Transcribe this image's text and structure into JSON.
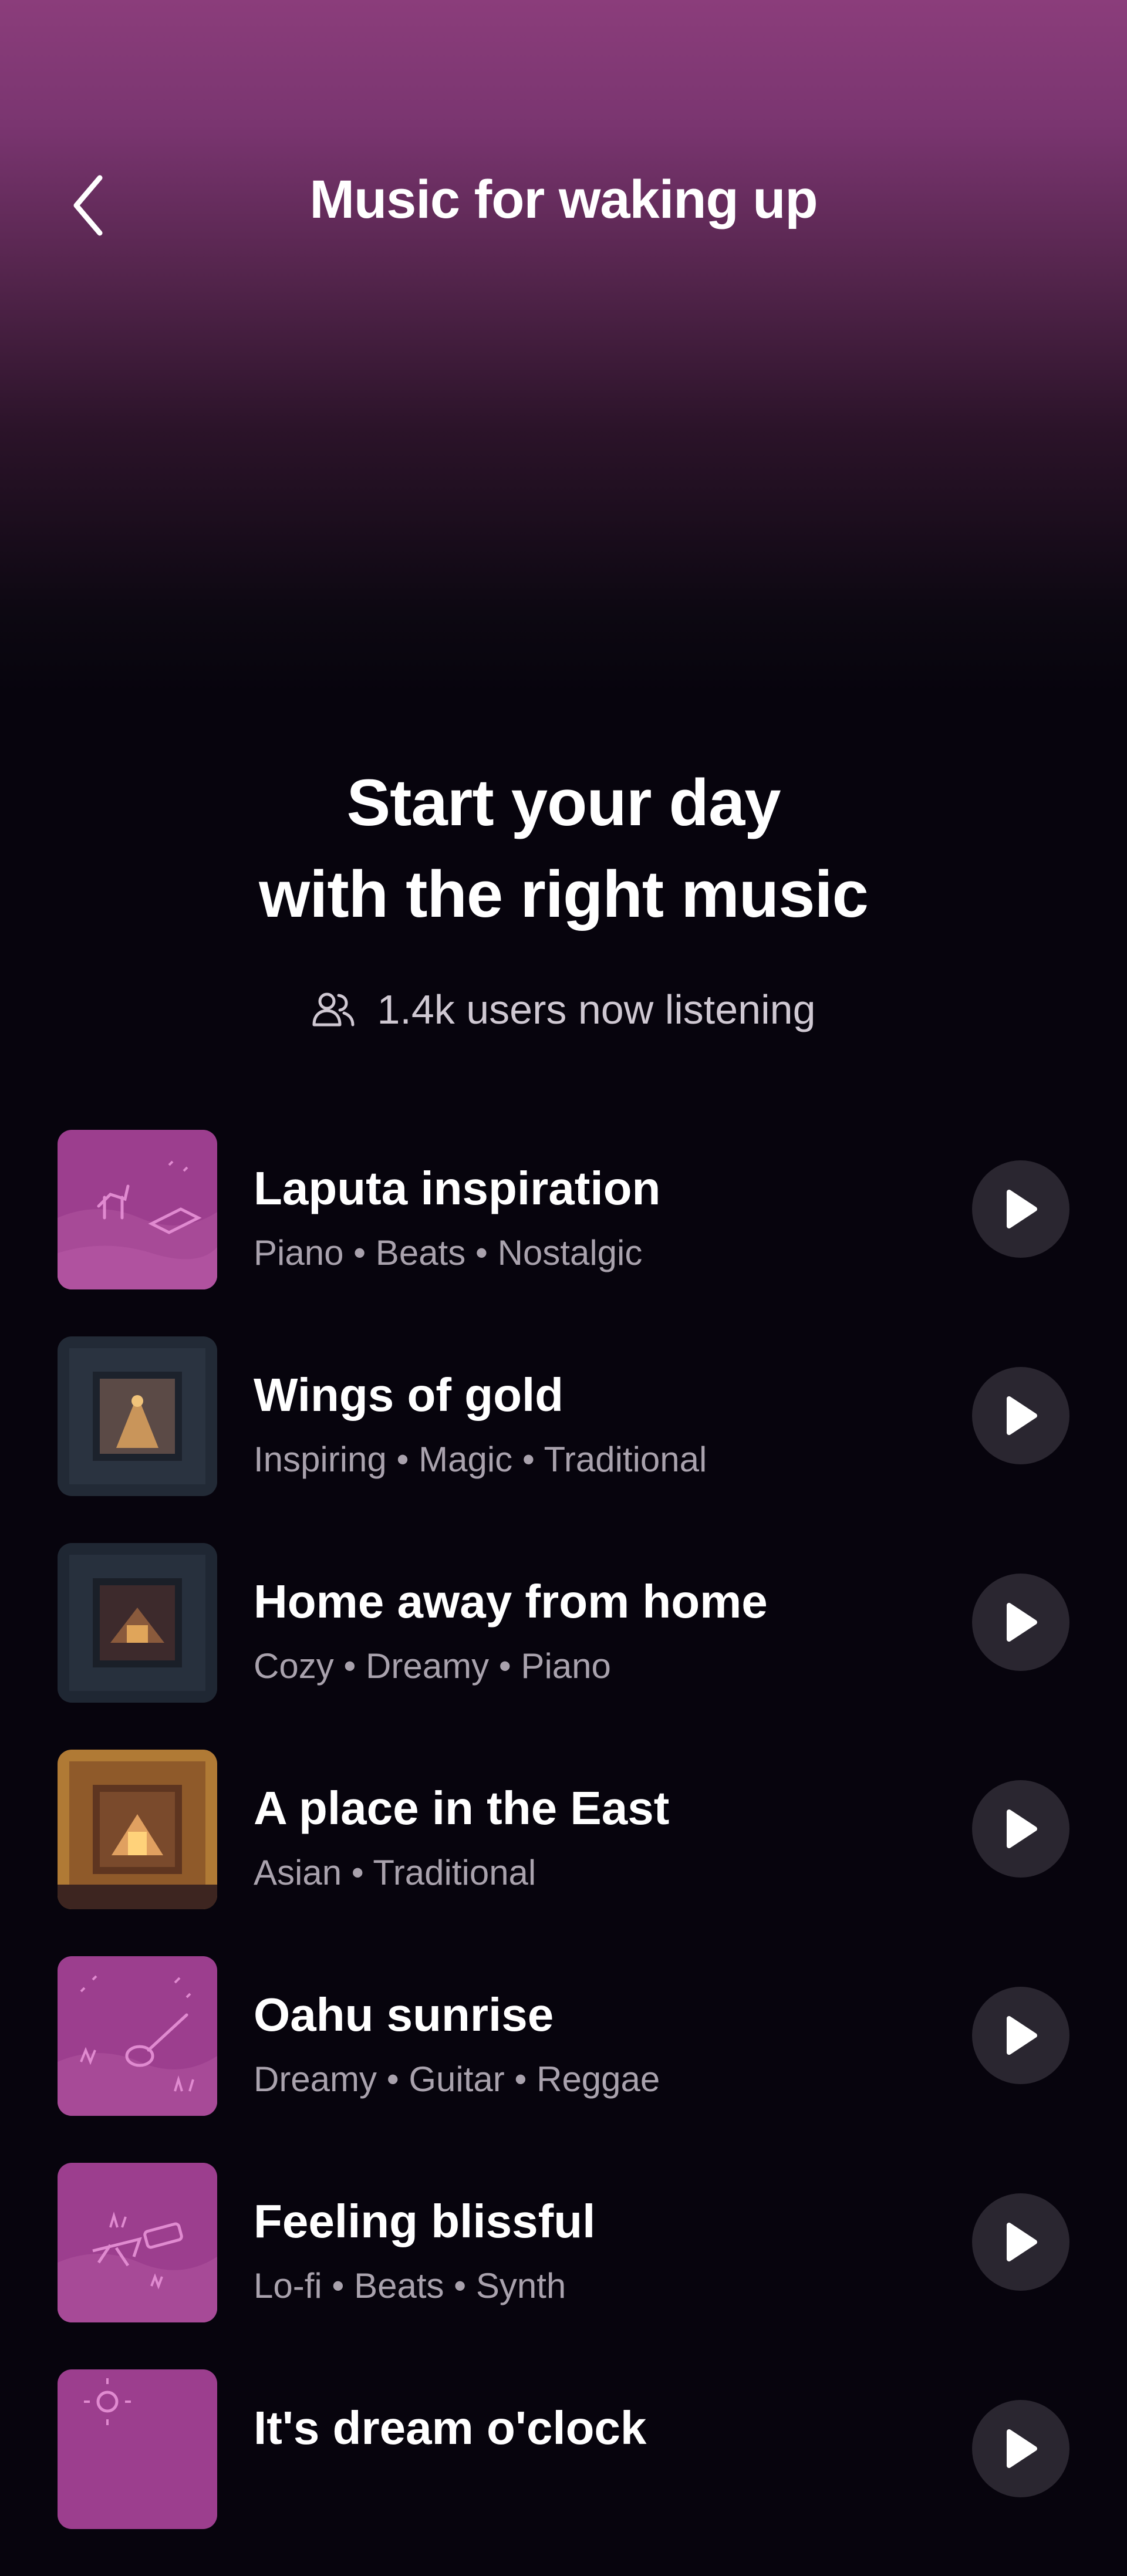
{
  "header": {
    "title": "Music for waking up",
    "back_icon": "chevron-left-icon"
  },
  "intro": {
    "headline_line1": "Start your day",
    "headline_line2": "with the right music",
    "listeners_icon": "users-icon",
    "listeners_text": "1.4k users now listening"
  },
  "colors": {
    "accent": "#8b3d7b",
    "background": "#07040d",
    "play_button": "#2a2630",
    "tag_text": "#a9a2ad"
  },
  "tracks": [
    {
      "title": "Laputa inspiration",
      "tags": "Piano • Beats • Nostalgic",
      "art": "pink-illustration"
    },
    {
      "title": "Wings of gold",
      "tags": "Inspiring • Magic • Traditional",
      "art": "dark-scene"
    },
    {
      "title": "Home away from home",
      "tags": "Cozy • Dreamy • Piano",
      "art": "dark-scene"
    },
    {
      "title": "A place in the East",
      "tags": "Asian • Traditional",
      "art": "warm-scene"
    },
    {
      "title": "Oahu sunrise",
      "tags": "Dreamy • Guitar • Reggae",
      "art": "pink-illustration"
    },
    {
      "title": "Feeling blissful",
      "tags": "Lo-fi • Beats • Synth",
      "art": "pink-illustration"
    },
    {
      "title": "It's dream o'clock",
      "tags": "",
      "art": "pink-illustration"
    }
  ]
}
